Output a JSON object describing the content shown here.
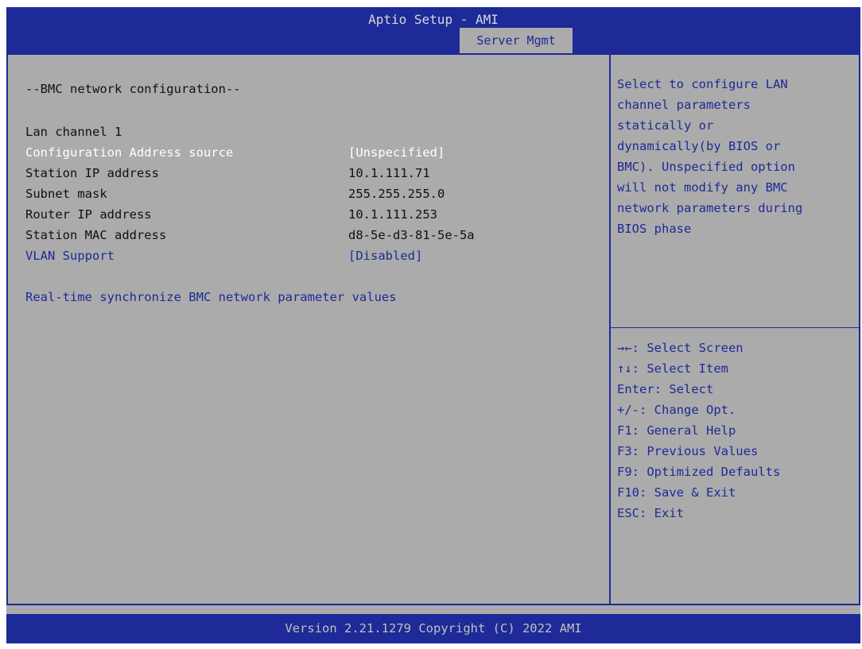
{
  "header": {
    "title": "Aptio Setup - AMI",
    "active_tab": "Server Mgmt"
  },
  "main": {
    "section_title": "--BMC network configuration--",
    "channel_label": "Lan channel 1",
    "items": [
      {
        "label": "Configuration Address source",
        "value": "[Unspecified]"
      },
      {
        "label": "Station IP address",
        "value": "10.1.111.71"
      },
      {
        "label": "Subnet mask",
        "value": "255.255.255.0"
      },
      {
        "label": "Router IP address",
        "value": "10.1.111.253"
      },
      {
        "label": "Station MAC address",
        "value": "d8-5e-d3-81-5e-5a"
      },
      {
        "label": "VLAN Support",
        "value": "[Disabled]"
      }
    ],
    "sync_link": "Real-time synchronize BMC network parameter values"
  },
  "help": {
    "lines": [
      "Select to configure LAN",
      "channel parameters",
      "statically or",
      "dynamically(by BIOS or",
      "BMC). Unspecified option",
      "will not modify any BMC",
      "network parameters during",
      "BIOS phase"
    ]
  },
  "keys": [
    "→←: Select Screen",
    "↑↓: Select Item",
    "Enter: Select",
    "+/-: Change Opt.",
    "F1: General Help",
    "F3: Previous Values",
    "F9: Optimized Defaults",
    "F10: Save & Exit",
    "ESC: Exit"
  ],
  "footer": {
    "version": "Version 2.21.1279 Copyright (C) 2022 AMI"
  },
  "colors": {
    "bios_blue": "#1d2a97",
    "panel_gray": "#ababab",
    "selected_text": "#ffffff"
  }
}
